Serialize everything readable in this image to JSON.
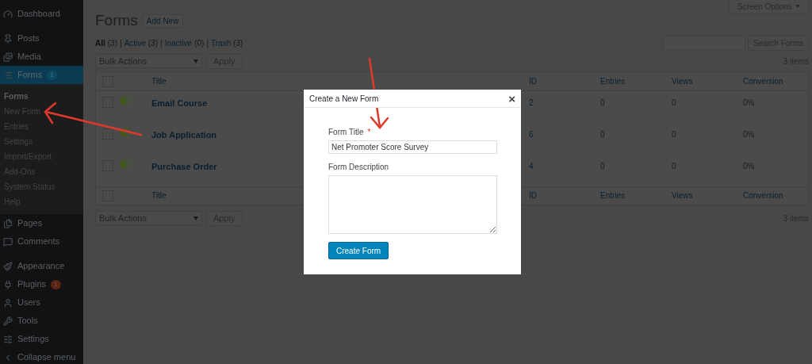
{
  "sidebar": {
    "groups": [
      {
        "items": [
          {
            "label": "Dashboard",
            "selected": false
          }
        ]
      },
      {
        "items": [
          {
            "label": "Posts",
            "selected": false
          },
          {
            "label": "Media",
            "selected": false
          },
          {
            "label": "Forms",
            "badge": "1",
            "selected": true,
            "children": [
              {
                "label": "Forms",
                "selected": true
              },
              {
                "label": "New Form",
                "selected": false
              },
              {
                "label": "Entries",
                "selected": false
              },
              {
                "label": "Settings",
                "selected": false
              },
              {
                "label": "Import/Export",
                "selected": false
              },
              {
                "label": "Add-Ons",
                "selected": false
              },
              {
                "label": "System Status",
                "selected": false
              },
              {
                "label": "Help",
                "selected": false
              }
            ]
          },
          {
            "label": "Pages",
            "selected": false
          },
          {
            "label": "Comments",
            "selected": false
          }
        ]
      },
      {
        "items": [
          {
            "label": "Appearance",
            "selected": false
          },
          {
            "label": "Plugins",
            "badge": "1",
            "selected": false
          },
          {
            "label": "Users",
            "selected": false
          },
          {
            "label": "Tools",
            "selected": false
          },
          {
            "label": "Settings",
            "selected": false
          },
          {
            "label": "Collapse menu",
            "selected": false
          }
        ]
      }
    ]
  },
  "screen_options": "Screen Options",
  "page_title": "Forms",
  "add_new": "Add New",
  "filters": [
    {
      "label": "All",
      "count": "(3)",
      "selected": true,
      "separator": "|"
    },
    {
      "label": "Active",
      "count": "(3)",
      "selected": false,
      "separator": "|"
    },
    {
      "label": "Inactive",
      "count": "(0)",
      "selected": false,
      "separator": "|"
    },
    {
      "label": "Trash",
      "count": "(3)",
      "selected": false
    }
  ],
  "search": {
    "button": "Search Forms"
  },
  "bulk_top": {
    "value": "Bulk Actions",
    "apply": "Apply",
    "items": "3 items"
  },
  "table": {
    "header_checked": false,
    "columns": [
      "Title",
      "ID",
      "Entries",
      "Views",
      "Conversion"
    ],
    "rows": [
      {
        "title": "Email Course",
        "id": "2",
        "entries": "0",
        "views": "0",
        "conversion": "0%",
        "active": true,
        "checked": false
      },
      {
        "title": "Job Application",
        "id": "6",
        "entries": "0",
        "views": "0",
        "conversion": "0%",
        "active": true,
        "checked": false
      },
      {
        "title": "Purchase Order",
        "id": "4",
        "entries": "0",
        "views": "0",
        "conversion": "0%",
        "active": true,
        "checked": false
      }
    ],
    "footer_checked": false,
    "footer_columns": [
      "Title",
      "ID",
      "Entries",
      "Views",
      "Conversion"
    ]
  },
  "bulk_bottom": {
    "value": "Bulk Actions",
    "apply": "Apply",
    "items": "3 items"
  },
  "modal": {
    "title": "Create a New Form",
    "close": "×",
    "title_label": "Form Title",
    "required": "*",
    "title_value": "Net Promoter Score Survey",
    "description_label": "Form Description",
    "button": "Create Form"
  }
}
